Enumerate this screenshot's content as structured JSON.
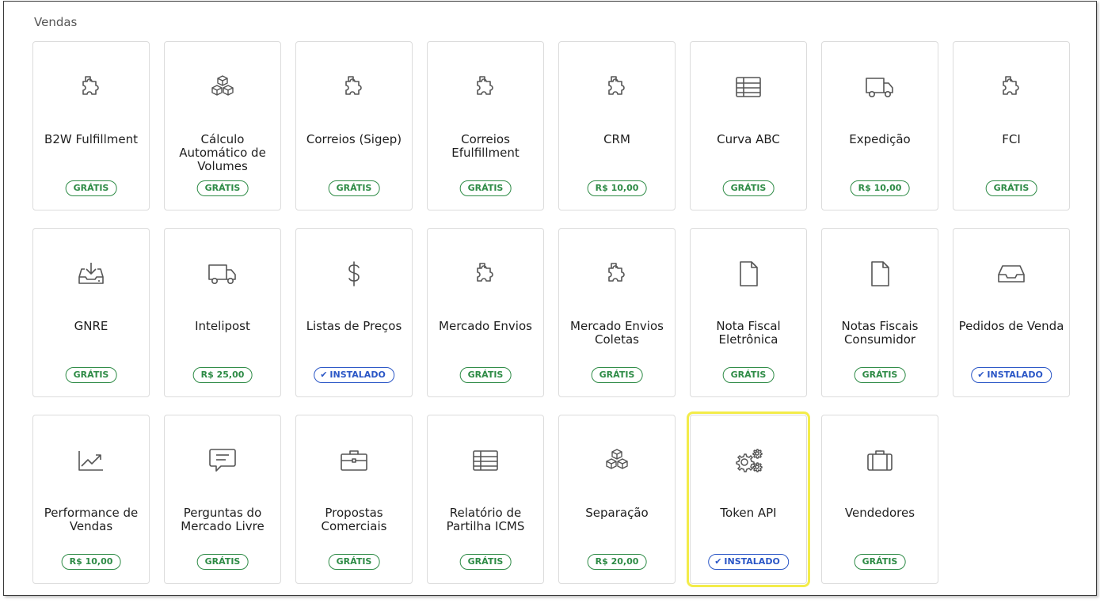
{
  "section": {
    "title": "Vendas"
  },
  "colors": {
    "free": "#2e8b46",
    "installed": "#2a56c6",
    "highlight": "#f3ec4a"
  },
  "cards": [
    {
      "name": "b2w-fulfillment",
      "title": "B2W Fulfillment",
      "icon": "puzzle-icon",
      "badge": "GRÁTIS",
      "badge_type": "free"
    },
    {
      "name": "calculo-automatico-volumes",
      "title": "Cálculo Automático de Volumes",
      "icon": "boxes-icon",
      "badge": "GRÁTIS",
      "badge_type": "free"
    },
    {
      "name": "correios-sigep",
      "title": "Correios (Sigep)",
      "icon": "puzzle-icon",
      "badge": "GRÁTIS",
      "badge_type": "free"
    },
    {
      "name": "correios-efulfillment",
      "title": "Correios Efulfillment",
      "icon": "puzzle-icon",
      "badge": "GRÁTIS",
      "badge_type": "free"
    },
    {
      "name": "crm",
      "title": "CRM",
      "icon": "puzzle-icon",
      "badge": "R$ 10,00",
      "badge_type": "price"
    },
    {
      "name": "curva-abc",
      "title": "Curva ABC",
      "icon": "table-icon",
      "badge": "GRÁTIS",
      "badge_type": "free"
    },
    {
      "name": "expedicao",
      "title": "Expedição",
      "icon": "truck-icon",
      "badge": "R$ 10,00",
      "badge_type": "price"
    },
    {
      "name": "fci",
      "title": "FCI",
      "icon": "puzzle-icon",
      "badge": "GRÁTIS",
      "badge_type": "free"
    },
    {
      "name": "gnre",
      "title": "GNRE",
      "icon": "download-tray-icon",
      "badge": "GRÁTIS",
      "badge_type": "free"
    },
    {
      "name": "intelipost",
      "title": "Intelipost",
      "icon": "truck-icon",
      "badge": "R$ 25,00",
      "badge_type": "price"
    },
    {
      "name": "listas-de-precos",
      "title": "Listas de Preços",
      "icon": "dollar-icon",
      "badge": "INSTALADO",
      "badge_type": "installed"
    },
    {
      "name": "mercado-envios",
      "title": "Mercado Envios",
      "icon": "puzzle-icon",
      "badge": "GRÁTIS",
      "badge_type": "free"
    },
    {
      "name": "mercado-envios-coletas",
      "title": "Mercado Envios Coletas",
      "icon": "puzzle-icon",
      "badge": "GRÁTIS",
      "badge_type": "free"
    },
    {
      "name": "nota-fiscal-eletronica",
      "title": "Nota Fiscal Eletrônica",
      "icon": "file-icon",
      "badge": "GRÁTIS",
      "badge_type": "free"
    },
    {
      "name": "notas-fiscais-consumidor",
      "title": "Notas Fiscais Consumidor",
      "icon": "file-icon",
      "badge": "GRÁTIS",
      "badge_type": "free"
    },
    {
      "name": "pedidos-de-venda",
      "title": "Pedidos de Venda",
      "icon": "inbox-icon",
      "badge": "INSTALADO",
      "badge_type": "installed"
    },
    {
      "name": "performance-de-vendas",
      "title": "Performance de Vendas",
      "icon": "chart-up-icon",
      "badge": "R$ 10,00",
      "badge_type": "price"
    },
    {
      "name": "perguntas-mercado-livre",
      "title": "Perguntas do Mercado Livre",
      "icon": "message-icon",
      "badge": "GRÁTIS",
      "badge_type": "free"
    },
    {
      "name": "propostas-comerciais",
      "title": "Propostas Comerciais",
      "icon": "briefcase-icon",
      "badge": "GRÁTIS",
      "badge_type": "free"
    },
    {
      "name": "relatorio-partilha-icms",
      "title": "Relatório de Partilha ICMS",
      "icon": "table-icon",
      "badge": "GRÁTIS",
      "badge_type": "free"
    },
    {
      "name": "separacao",
      "title": "Separação",
      "icon": "boxes-icon",
      "badge": "R$ 20,00",
      "badge_type": "price"
    },
    {
      "name": "token-api",
      "title": "Token API",
      "icon": "gears-icon",
      "badge": "INSTALADO",
      "badge_type": "installed",
      "highlighted": true
    },
    {
      "name": "vendedores",
      "title": "Vendedores",
      "icon": "suitcase-icon",
      "badge": "GRÁTIS",
      "badge_type": "free"
    }
  ]
}
